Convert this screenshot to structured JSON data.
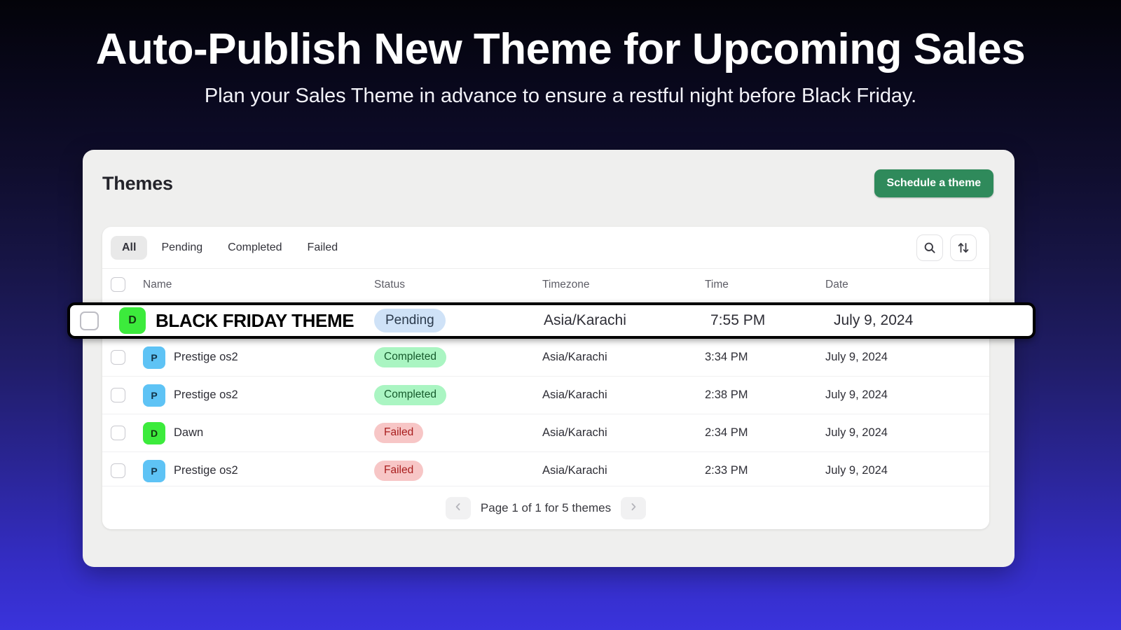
{
  "hero": {
    "title": "Auto-Publish New Theme for Upcoming Sales",
    "subtitle": "Plan your Sales Theme in advance to ensure a restful night before Black Friday."
  },
  "panel": {
    "title": "Themes",
    "schedule_button": "Schedule a theme"
  },
  "toolbar": {
    "tabs": [
      {
        "label": "All",
        "active": true
      },
      {
        "label": "Pending",
        "active": false
      },
      {
        "label": "Completed",
        "active": false
      },
      {
        "label": "Failed",
        "active": false
      }
    ],
    "search_icon": "search-icon",
    "sort_icon": "sort-arrows-icon"
  },
  "table": {
    "columns": [
      "Name",
      "Status",
      "Timezone",
      "Time",
      "Date"
    ],
    "rows": [
      {
        "initial": "D",
        "avatar_color": "#3ceb3c",
        "name": "BLACK FRIDAY THEME",
        "status": "Pending",
        "status_kind": "pending",
        "timezone": "Asia/Karachi",
        "time": "7:55 PM",
        "date": "July 9, 2024",
        "highlighted": true
      },
      {
        "initial": "P",
        "avatar_color": "#5ec3f5",
        "name": "Prestige os2",
        "status": "Completed",
        "status_kind": "completed",
        "timezone": "Asia/Karachi",
        "time": "3:34 PM",
        "date": "July 9, 2024",
        "highlighted": false
      },
      {
        "initial": "P",
        "avatar_color": "#5ec3f5",
        "name": "Prestige os2",
        "status": "Completed",
        "status_kind": "completed",
        "timezone": "Asia/Karachi",
        "time": "2:38 PM",
        "date": "July 9, 2024",
        "highlighted": false
      },
      {
        "initial": "D",
        "avatar_color": "#3ceb3c",
        "name": "Dawn",
        "status": "Failed",
        "status_kind": "failed",
        "timezone": "Asia/Karachi",
        "time": "2:34 PM",
        "date": "July 9, 2024",
        "highlighted": false
      },
      {
        "initial": "P",
        "avatar_color": "#5ec3f5",
        "name": "Prestige os2",
        "status": "Failed",
        "status_kind": "failed",
        "timezone": "Asia/Karachi",
        "time": "2:33 PM",
        "date": "July 9, 2024",
        "highlighted": false
      }
    ]
  },
  "pagination": {
    "prev_icon": "chevron-left-icon",
    "next_icon": "chevron-right-icon",
    "label": "Page 1 of 1 for 5 themes"
  },
  "colors": {
    "accent_green": "#2f8a5b",
    "badge_pending_bg": "#cfe2f7",
    "badge_completed_bg": "#aaf5c2",
    "badge_failed_bg": "#f7c6c6",
    "panel_bg": "#efefee",
    "bg_top": "#030309",
    "bg_bottom": "#3a33dc"
  }
}
